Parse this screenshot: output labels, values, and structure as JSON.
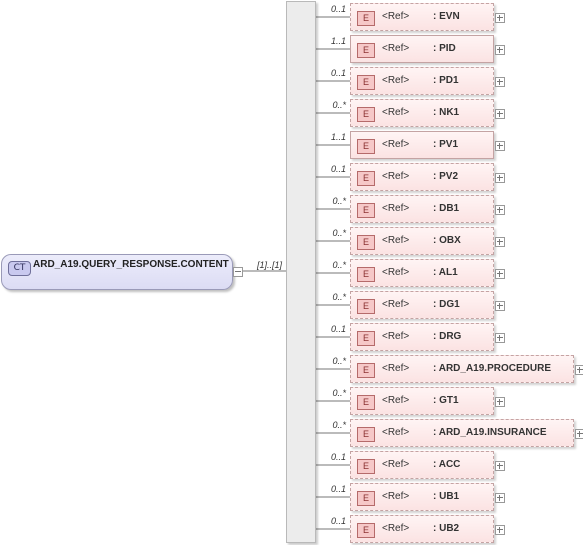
{
  "root": {
    "badge": "CT",
    "name": "ARD_A19.QUERY_RESPONSE.CONTENT",
    "multiplicity": "[1]..[1]"
  },
  "elements": [
    {
      "mult": "0..1",
      "badge": "E",
      "ref": "<Ref>",
      "name": ": EVN",
      "optional": true
    },
    {
      "mult": "1..1",
      "badge": "E",
      "ref": "<Ref>",
      "name": ": PID",
      "optional": false
    },
    {
      "mult": "0..1",
      "badge": "E",
      "ref": "<Ref>",
      "name": ": PD1",
      "optional": true
    },
    {
      "mult": "0..*",
      "badge": "E",
      "ref": "<Ref>",
      "name": ": NK1",
      "optional": true
    },
    {
      "mult": "1..1",
      "badge": "E",
      "ref": "<Ref>",
      "name": ": PV1",
      "optional": false
    },
    {
      "mult": "0..1",
      "badge": "E",
      "ref": "<Ref>",
      "name": ": PV2",
      "optional": true
    },
    {
      "mult": "0..*",
      "badge": "E",
      "ref": "<Ref>",
      "name": ": DB1",
      "optional": true
    },
    {
      "mult": "0..*",
      "badge": "E",
      "ref": "<Ref>",
      "name": ": OBX",
      "optional": true
    },
    {
      "mult": "0..*",
      "badge": "E",
      "ref": "<Ref>",
      "name": ": AL1",
      "optional": true
    },
    {
      "mult": "0..*",
      "badge": "E",
      "ref": "<Ref>",
      "name": ": DG1",
      "optional": true
    },
    {
      "mult": "0..1",
      "badge": "E",
      "ref": "<Ref>",
      "name": ": DRG",
      "optional": true
    },
    {
      "mult": "0..*",
      "badge": "E",
      "ref": "<Ref>",
      "name": ": ARD_A19.PROCEDURE",
      "optional": true
    },
    {
      "mult": "0..*",
      "badge": "E",
      "ref": "<Ref>",
      "name": ": GT1",
      "optional": true
    },
    {
      "mult": "0..*",
      "badge": "E",
      "ref": "<Ref>",
      "name": ": ARD_A19.INSURANCE",
      "optional": true
    },
    {
      "mult": "0..1",
      "badge": "E",
      "ref": "<Ref>",
      "name": ": ACC",
      "optional": true
    },
    {
      "mult": "0..1",
      "badge": "E",
      "ref": "<Ref>",
      "name": ": UB1",
      "optional": true
    },
    {
      "mult": "0..1",
      "badge": "E",
      "ref": "<Ref>",
      "name": ": UB2",
      "optional": true
    }
  ]
}
